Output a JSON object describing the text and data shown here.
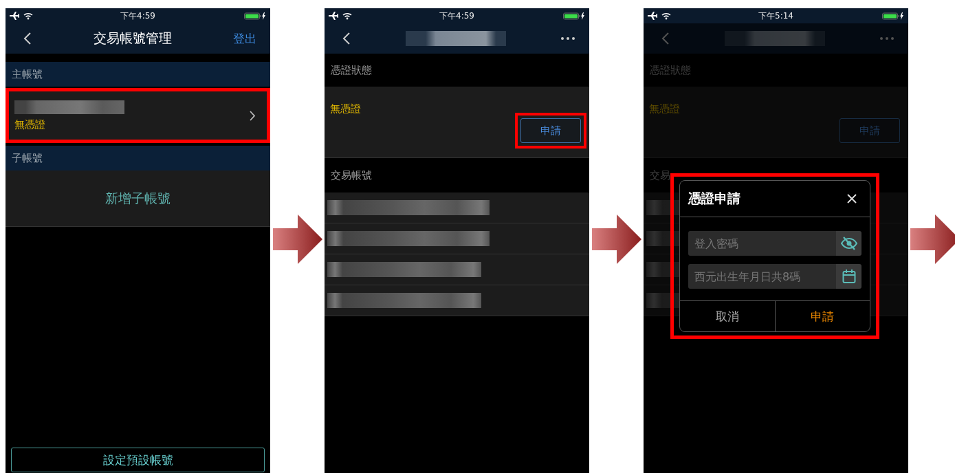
{
  "screens": [
    {
      "kind": "accounts",
      "status_time": "下午4:59",
      "title": "交易帳號管理",
      "nav_action": "登出",
      "sections": [
        {
          "header": "主帳號",
          "rows": [
            {
              "kind": "account",
              "status": "無憑證",
              "highlighted": true
            }
          ]
        },
        {
          "header": "子帳號",
          "rows": [
            {
              "kind": "add",
              "label": "新增子帳號",
              "highlighted": false
            }
          ]
        }
      ],
      "footer_button": "設定預設帳號"
    },
    {
      "kind": "detail",
      "status_time": "下午4:59",
      "dimmed": false,
      "cert_header": "憑證狀態",
      "cert_status": "無憑證",
      "apply_button": {
        "label": "申請",
        "highlighted": true
      },
      "accounts_header": "交易帳號"
    },
    {
      "kind": "detail",
      "status_time": "下午5:14",
      "dimmed": true,
      "cert_header": "憑證狀態",
      "cert_status": "無憑證",
      "apply_button": {
        "label": "申請",
        "highlighted": false
      },
      "accounts_header": "交易",
      "dialog": {
        "title": "憑證申請",
        "highlighted": true,
        "fields": [
          {
            "kind": "password",
            "placeholder": "登入密碼"
          },
          {
            "kind": "date",
            "placeholder": "西元出生年月日共8碼"
          }
        ],
        "cancel": "取消",
        "confirm": "申請"
      }
    }
  ]
}
